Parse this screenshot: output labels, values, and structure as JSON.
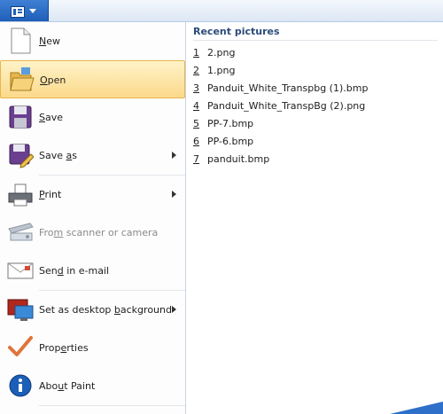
{
  "app_button": {
    "icon": "paint-app-icon"
  },
  "menu": {
    "items": [
      {
        "pre": "",
        "key": "N",
        "post": "ew",
        "icon": "new-document-icon",
        "submenu": false,
        "disabled": false
      },
      {
        "pre": "",
        "key": "O",
        "post": "pen",
        "icon": "open-folder-icon",
        "submenu": false,
        "disabled": false
      },
      {
        "pre": "",
        "key": "S",
        "post": "ave",
        "icon": "save-disk-icon",
        "submenu": false,
        "disabled": false
      },
      {
        "pre": "Save ",
        "key": "a",
        "post": "s",
        "icon": "save-as-icon",
        "submenu": true,
        "disabled": false
      },
      {
        "pre": "",
        "key": "P",
        "post": "rint",
        "icon": "printer-icon",
        "submenu": true,
        "disabled": false
      },
      {
        "pre": "Fro",
        "key": "m",
        "post": " scanner or camera",
        "icon": "scanner-icon",
        "submenu": false,
        "disabled": true
      },
      {
        "pre": "Sen",
        "key": "d",
        "post": " in e-mail",
        "icon": "email-icon",
        "submenu": false,
        "disabled": false
      },
      {
        "pre": "Set as desktop ",
        "key": "b",
        "post": "ackground",
        "icon": "desktop-background-icon",
        "submenu": true,
        "disabled": false
      },
      {
        "pre": "Prop",
        "key": "e",
        "post": "rties",
        "icon": "properties-checkmark-icon",
        "submenu": false,
        "disabled": false
      },
      {
        "pre": "Abo",
        "key": "u",
        "post": "t Paint",
        "icon": "about-info-icon",
        "submenu": false,
        "disabled": false
      }
    ]
  },
  "recent": {
    "title": "Recent pictures",
    "files": [
      {
        "num": "1",
        "name": "2.png"
      },
      {
        "num": "2",
        "name": "1.png"
      },
      {
        "num": "3",
        "name": "Panduit_White_Transpbg (1).bmp"
      },
      {
        "num": "4",
        "name": "Panduit_White_TranspBg (2).png"
      },
      {
        "num": "5",
        "name": "PP-7.bmp"
      },
      {
        "num": "6",
        "name": "PP-6.bmp"
      },
      {
        "num": "7",
        "name": "panduit.bmp"
      }
    ]
  }
}
